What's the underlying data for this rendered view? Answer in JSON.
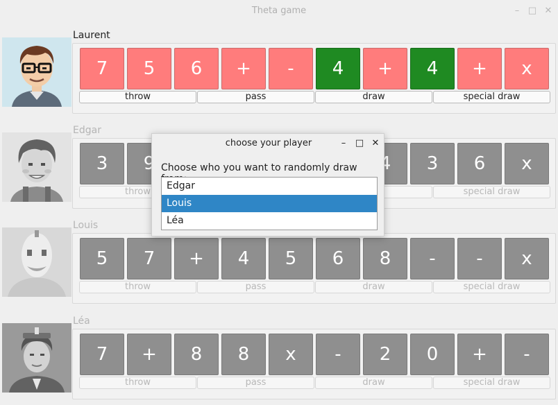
{
  "window": {
    "title": "Theta game",
    "minimize": "–",
    "maximize": "□",
    "close": "✕"
  },
  "action_labels": [
    "throw",
    "pass",
    "draw",
    "special draw"
  ],
  "players": [
    {
      "name": "Laurent",
      "active": true,
      "cards": [
        {
          "value": "7",
          "color": "red"
        },
        {
          "value": "5",
          "color": "red"
        },
        {
          "value": "6",
          "color": "red"
        },
        {
          "value": "+",
          "color": "red"
        },
        {
          "value": "-",
          "color": "red"
        },
        {
          "value": "4",
          "color": "green"
        },
        {
          "value": "+",
          "color": "red"
        },
        {
          "value": "4",
          "color": "green"
        },
        {
          "value": "+",
          "color": "red"
        },
        {
          "value": "x",
          "color": "red"
        }
      ]
    },
    {
      "name": "Edgar",
      "active": false,
      "cards": [
        {
          "value": "3",
          "color": "grey"
        },
        {
          "value": "9",
          "color": "grey"
        },
        {
          "value": "",
          "color": "grey"
        },
        {
          "value": "",
          "color": "grey"
        },
        {
          "value": "",
          "color": "grey"
        },
        {
          "value": "",
          "color": "grey"
        },
        {
          "value": "4",
          "color": "grey"
        },
        {
          "value": "3",
          "color": "grey"
        },
        {
          "value": "6",
          "color": "grey"
        },
        {
          "value": "x",
          "color": "grey"
        }
      ]
    },
    {
      "name": "Louis",
      "active": false,
      "cards": [
        {
          "value": "5",
          "color": "grey"
        },
        {
          "value": "7",
          "color": "grey"
        },
        {
          "value": "+",
          "color": "grey"
        },
        {
          "value": "4",
          "color": "grey"
        },
        {
          "value": "5",
          "color": "grey"
        },
        {
          "value": "6",
          "color": "grey"
        },
        {
          "value": "8",
          "color": "grey"
        },
        {
          "value": "-",
          "color": "grey"
        },
        {
          "value": "-",
          "color": "grey"
        },
        {
          "value": "x",
          "color": "grey"
        }
      ]
    },
    {
      "name": "Léa",
      "active": false,
      "cards": [
        {
          "value": "7",
          "color": "grey"
        },
        {
          "value": "+",
          "color": "grey"
        },
        {
          "value": "8",
          "color": "grey"
        },
        {
          "value": "8",
          "color": "grey"
        },
        {
          "value": "x",
          "color": "grey"
        },
        {
          "value": "-",
          "color": "grey"
        },
        {
          "value": "2",
          "color": "grey"
        },
        {
          "value": "0",
          "color": "grey"
        },
        {
          "value": "+",
          "color": "grey"
        },
        {
          "value": "-",
          "color": "grey"
        }
      ]
    }
  ],
  "dialog": {
    "title": "choose your player",
    "minimize": "–",
    "maximize": "□",
    "close": "✕",
    "prompt": "Choose who you want to randomly draw from:",
    "options": [
      "Edgar",
      "Louis",
      "Léa"
    ],
    "selected": "Louis"
  },
  "colors": {
    "red": "#ff7c7c",
    "green": "#1f8a22",
    "grey": "#8f8f8f",
    "selection": "#2f86c6"
  }
}
